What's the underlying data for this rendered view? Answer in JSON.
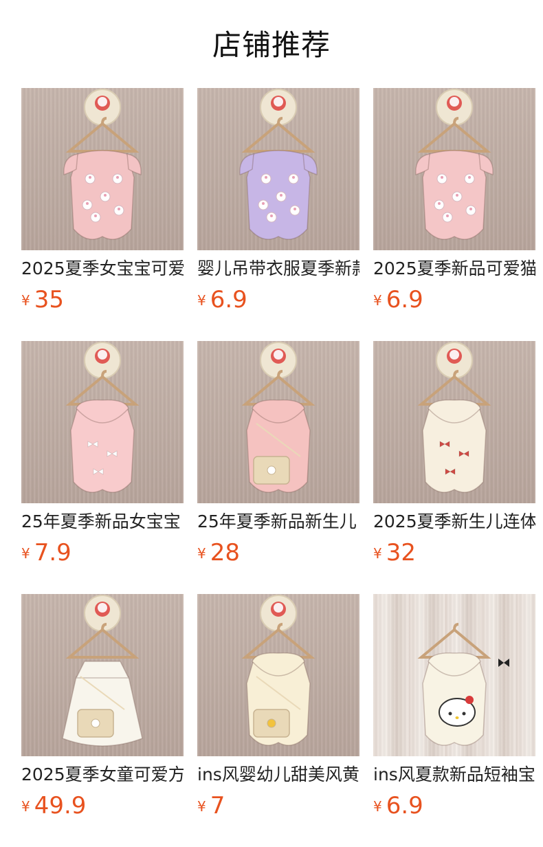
{
  "title": "店铺推荐",
  "currency": "¥",
  "products": [
    {
      "name": "2025夏季女宝宝可爱",
      "price": "35",
      "color": "#f3c3c4",
      "variant": "flutter",
      "deco": "bunnies"
    },
    {
      "name": "婴儿吊带衣服夏季新款",
      "price": "6.9",
      "color": "#c7b6e6",
      "variant": "flutter",
      "deco": "kitties"
    },
    {
      "name": "2025夏季新品可爱猫",
      "price": "6.9",
      "color": "#f4c6c7",
      "variant": "flutter",
      "deco": "kitties"
    },
    {
      "name": "25年夏季新品女宝宝",
      "price": "7.9",
      "color": "#f8cbcc",
      "variant": "collar",
      "deco": "bows"
    },
    {
      "name": "25年夏季新品新生儿",
      "price": "28",
      "color": "#f5c2c0",
      "variant": "collar",
      "deco": "bag"
    },
    {
      "name": "2025夏季新生儿连体",
      "price": "32",
      "color": "#f7efdf",
      "variant": "collar",
      "deco": "redbows"
    },
    {
      "name": "2025夏季女童可爱方",
      "price": "49.9",
      "color": "#f8f5ec",
      "variant": "dress",
      "deco": "bag"
    },
    {
      "name": "ins风婴幼儿甜美风黄",
      "price": "7",
      "color": "#f8efd6",
      "variant": "collar",
      "deco": "basket"
    },
    {
      "name": "ins风夏款新品短袖宝",
      "price": "6.9",
      "color": "#f8f3e4",
      "variant": "kitty",
      "deco": "kittyface"
    }
  ]
}
